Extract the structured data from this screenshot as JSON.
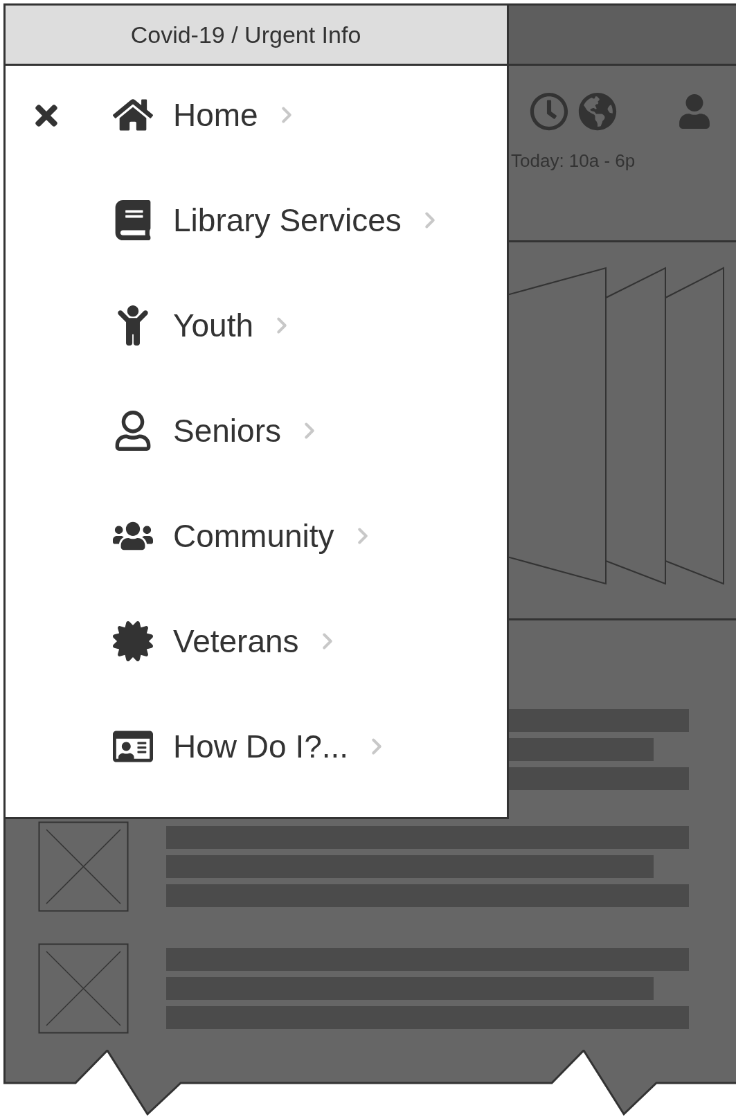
{
  "urgent_bar": {
    "label": "Covid-19 / Urgent Info"
  },
  "menu": {
    "items": [
      {
        "label": "Home",
        "kind": "home"
      },
      {
        "label": "Library Services",
        "kind": "book"
      },
      {
        "label": "Youth",
        "kind": "child"
      },
      {
        "label": "Seniors",
        "kind": "person"
      },
      {
        "label": "Community",
        "kind": "group"
      },
      {
        "label": "Veterans",
        "kind": "badge"
      },
      {
        "label": "How Do I?...",
        "kind": "card"
      }
    ]
  },
  "header": {
    "hours": "Today: 10a - 6p"
  }
}
